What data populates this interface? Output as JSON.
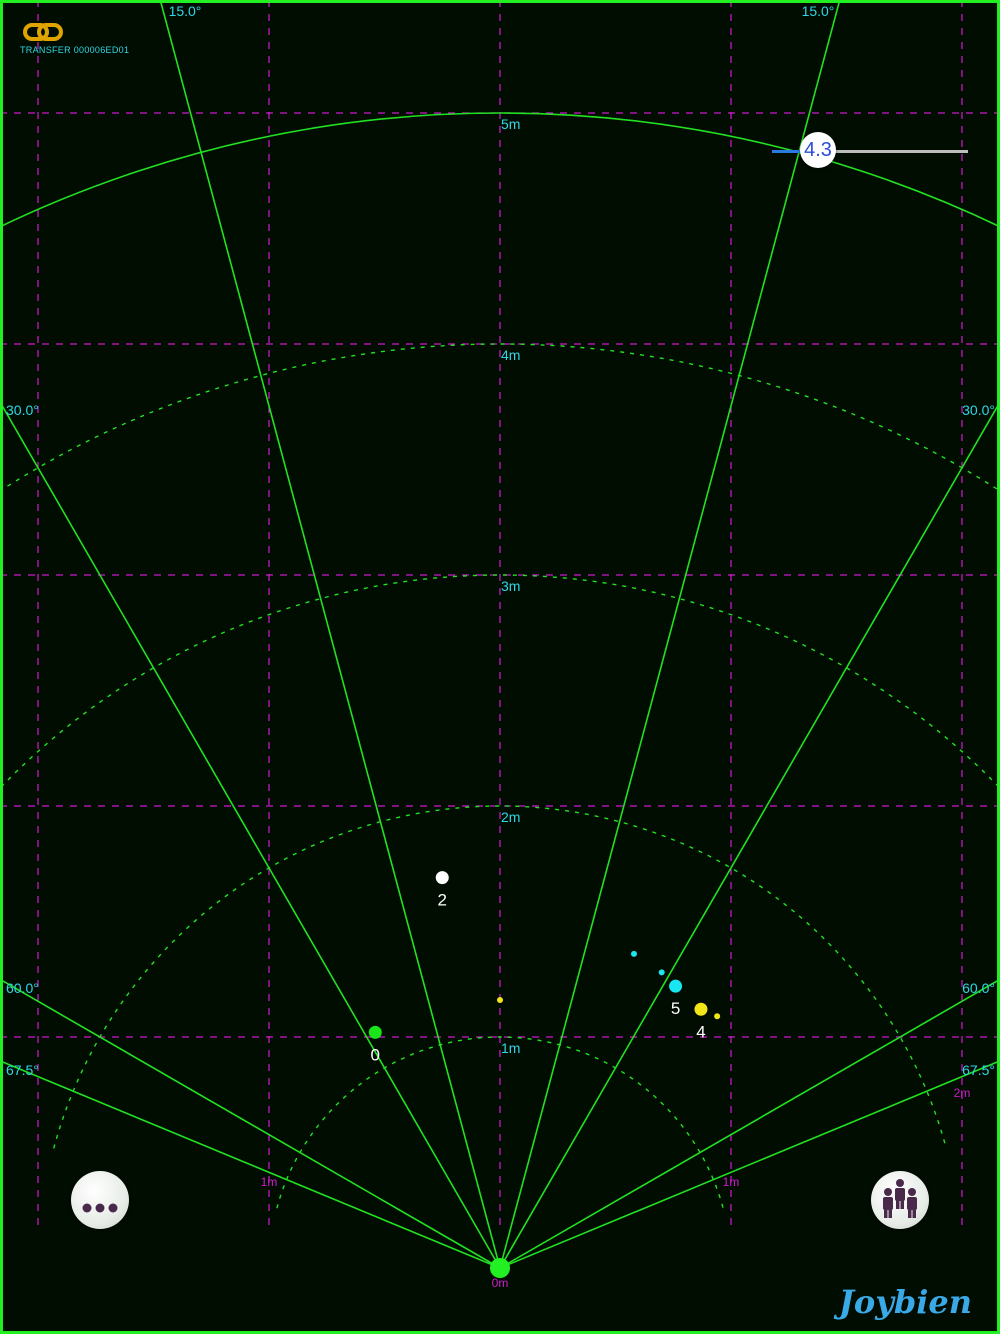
{
  "header": {
    "transfer_label": "TRANSFER 000006ED01"
  },
  "ranges": [
    {
      "label": "1m",
      "value": 1
    },
    {
      "label": "2m",
      "value": 2
    },
    {
      "label": "3m",
      "value": 3
    },
    {
      "label": "4m",
      "value": 4
    },
    {
      "label": "5m",
      "value": 5
    }
  ],
  "angle_labels": {
    "a15": "15.0°",
    "a30": "30.0°",
    "a60": "60.0°",
    "a675": "67.5°"
  },
  "axis_labels": {
    "origin": "0m",
    "lateral_1m": "1m",
    "lateral_2m": "2m"
  },
  "targets": [
    {
      "id": "0",
      "x": -0.54,
      "y": 1.02,
      "color": "#19e619",
      "label": "0"
    },
    {
      "id": "2",
      "x": -0.25,
      "y": 1.69,
      "color": "#ffffff",
      "label": "2"
    },
    {
      "id": "5",
      "x": 0.76,
      "y": 1.22,
      "color": "#19e6f0",
      "label": "5"
    },
    {
      "id": "4",
      "x": 0.87,
      "y": 1.12,
      "color": "#f2e619",
      "label": "4"
    }
  ],
  "trail_points": [
    {
      "x": 0.0,
      "y": 1.16,
      "color": "#f2e619"
    },
    {
      "x": 0.94,
      "y": 1.09,
      "color": "#f2e619"
    },
    {
      "x": 0.7,
      "y": 1.28,
      "color": "#19e6f0"
    },
    {
      "x": 0.58,
      "y": 1.36,
      "color": "#19e6f0"
    }
  ],
  "range_slider": {
    "value": "4.3",
    "fraction": 0.21
  },
  "brand": "Joybien",
  "colors": {
    "background": "#020d02",
    "radar_line": "#22e022",
    "grid": "#d01ad0",
    "label": "#2fd6e6"
  }
}
